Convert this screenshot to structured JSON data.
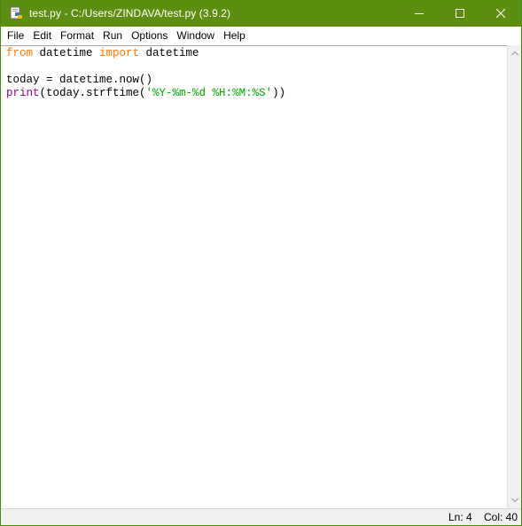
{
  "window": {
    "title": "test.py - C:/Users/ZINDAVA/test.py (3.9.2)",
    "accent_color": "#5c8f0f"
  },
  "title_controls": {
    "minimize_icon": "minimize-icon",
    "maximize_icon": "maximize-icon",
    "close_icon": "close-icon"
  },
  "menu": {
    "items": [
      "File",
      "Edit",
      "Format",
      "Run",
      "Options",
      "Window",
      "Help"
    ]
  },
  "editor": {
    "line1": {
      "kw1": "from",
      "t1": " datetime ",
      "kw2": "import",
      "t2": " datetime"
    },
    "line2": "",
    "line3": "today = datetime.now()",
    "line4": {
      "bi": "print",
      "t1": "(today.strftime(",
      "str": "'%Y-%m-%d %H:%M:%S'",
      "t2": "))"
    },
    "colors": {
      "keyword": "#ff7700",
      "builtin": "#900090",
      "string": "#00aa00"
    }
  },
  "status": {
    "ln": "Ln: 4",
    "col": "Col: 40"
  }
}
